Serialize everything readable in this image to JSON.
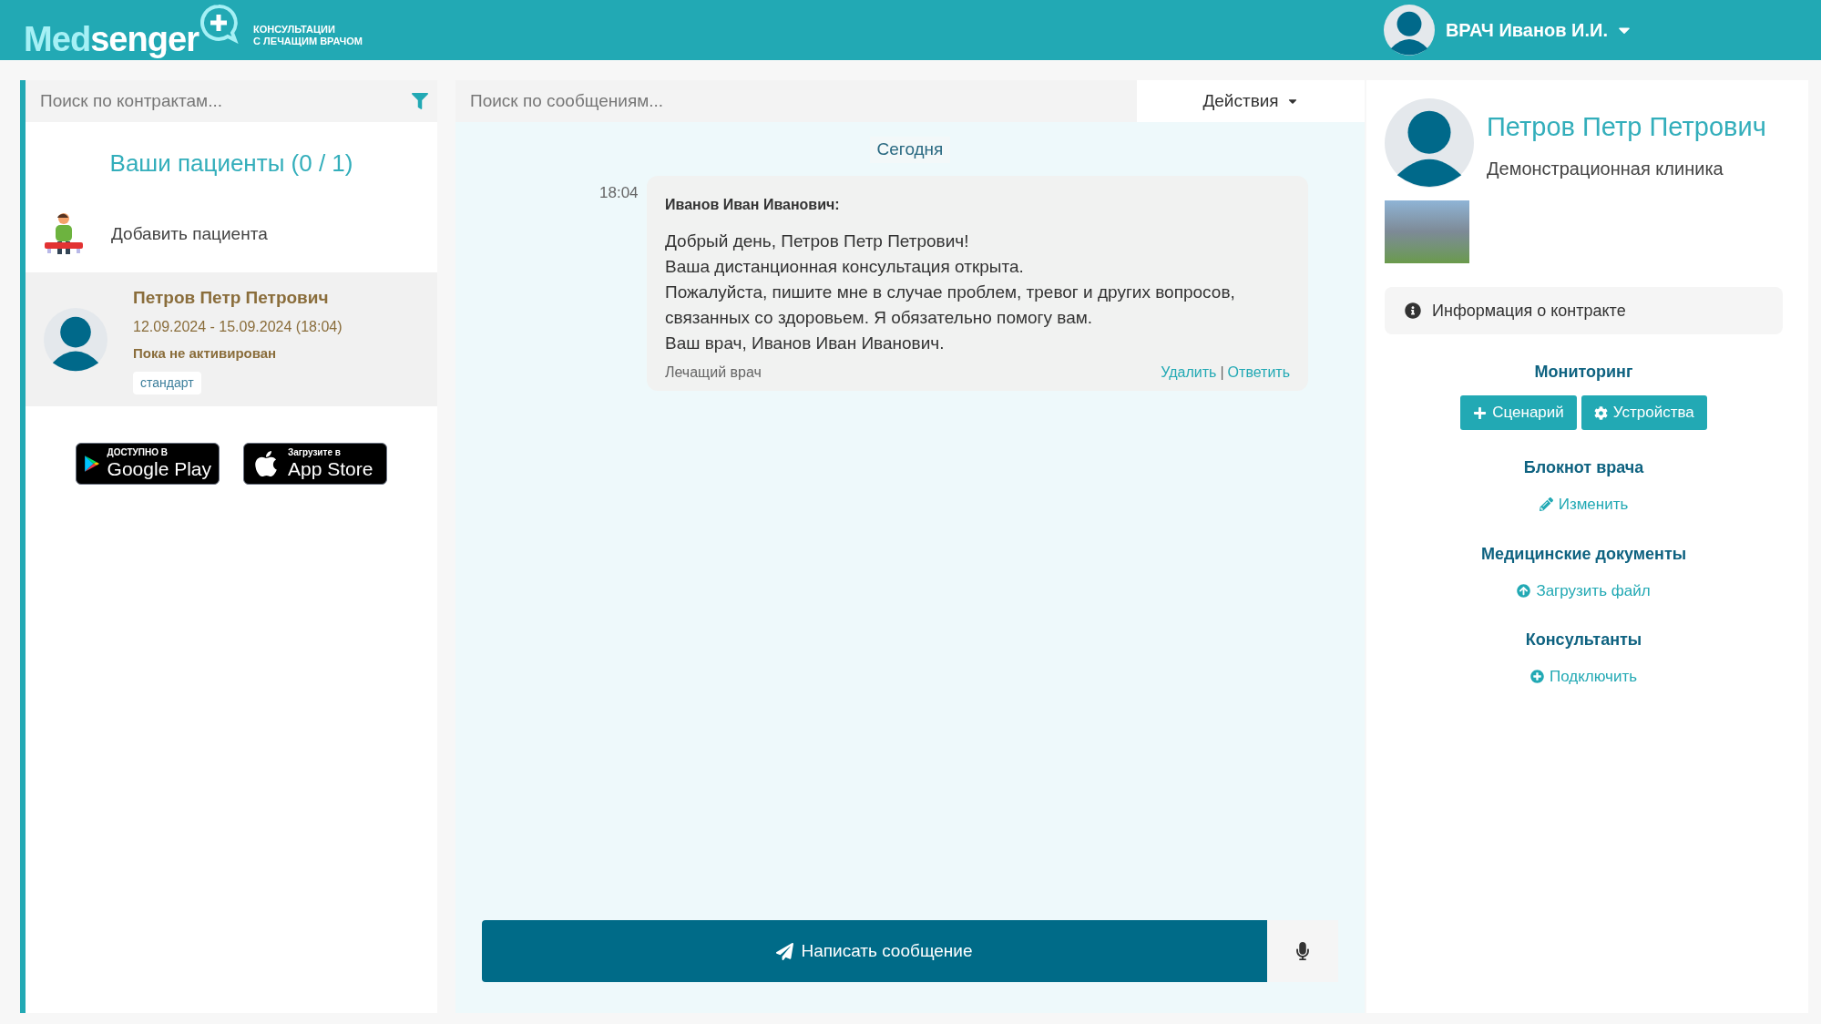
{
  "header": {
    "brand_prefix": "Med",
    "brand_suffix": "senger",
    "tagline": [
      "КОНСУЛЬТАЦИИ",
      "С ЛЕЧАЩИМ ВРАЧОМ"
    ],
    "user": "ВРАЧ Иванов И.И."
  },
  "sidebar": {
    "search": {
      "placeholder": "Поиск по контрактам..."
    },
    "title": "Ваши пациенты (0 / 1)",
    "add_patient": "Добавить пациента",
    "patients": [
      {
        "name": "Петров Петр Петрович",
        "dates": "12.09.2024 - 15.09.2024 (18:04)",
        "status": "Пока не активирован",
        "tag": "стандарт",
        "selected": true
      }
    ],
    "stores": [
      {
        "kind": "google",
        "small": "ДОСТУПНО В",
        "big": "Google Play"
      },
      {
        "kind": "apple",
        "small": "Загрузите в",
        "big": "App Store"
      }
    ]
  },
  "chat": {
    "search": {
      "placeholder": "Поиск по сообщениям..."
    },
    "actions_button": "Действия",
    "date": "Сегодня",
    "messages": [
      {
        "time": "18:04",
        "author": "Иванов Иван Иванович:",
        "lines": [
          "Добрый день, Петров Петр Петрович!",
          "Ваша дистанционная консультация открыта.",
          "Пожалуйста, пишите мне в случае проблем, тревог и других вопросов,",
          "связанных со здоровьем. Я обязательно помогу вам.",
          "Ваш врач, Иванов Иван Иванович."
        ],
        "role": "Лечащий врач",
        "links": [
          "Удалить",
          "Ответить"
        ],
        "separator": "|"
      }
    ],
    "compose_button": "Написать сообщение"
  },
  "contract": {
    "patient": "Петров Петр Петрович",
    "clinic": "Демонстрационная клиника",
    "info": "Информация о контракте",
    "sections": [
      {
        "title": "Мониторинг",
        "kind": "buttons",
        "actions": [
          {
            "label": "Сценарий"
          },
          {
            "label": "Устройства"
          }
        ]
      },
      {
        "title": "Блокнот врача",
        "kind": "link",
        "actions": [
          {
            "label": "Изменить"
          }
        ]
      },
      {
        "title": "Медицинские документы",
        "kind": "link",
        "actions": [
          {
            "label": "Загрузить файл"
          }
        ]
      },
      {
        "title": "Консультанты",
        "kind": "link",
        "actions": [
          {
            "label": "Подключить"
          }
        ]
      }
    ]
  }
}
